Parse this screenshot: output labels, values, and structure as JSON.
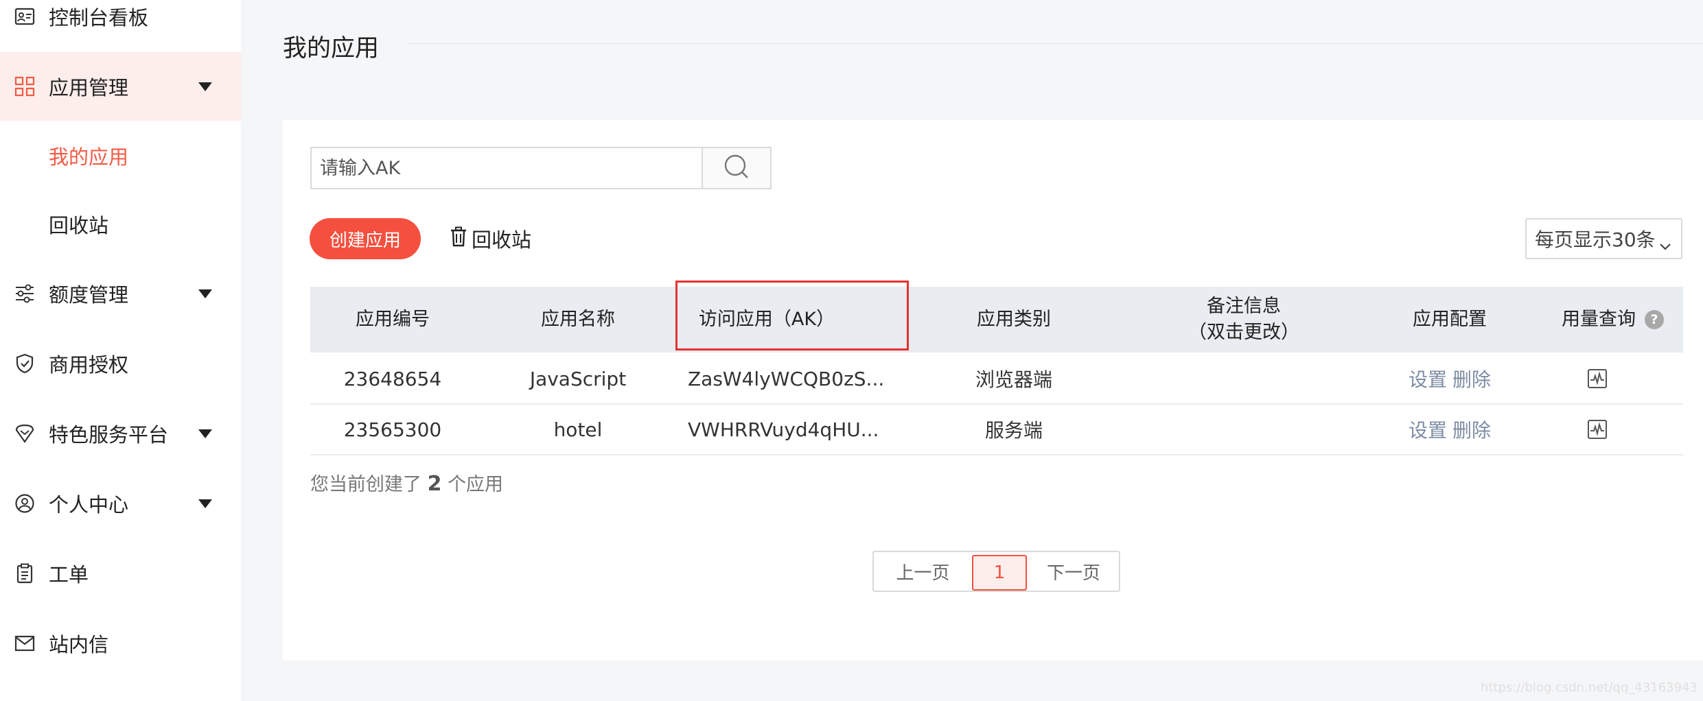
{
  "sidebar": {
    "items": [
      {
        "label": "控制台看板",
        "icon": "id-card-icon"
      },
      {
        "label": "应用管理",
        "icon": "grid-icon",
        "expanded": true
      },
      {
        "label": "我的应用",
        "sub": true,
        "selected": true
      },
      {
        "label": "回收站",
        "sub": true
      },
      {
        "label": "额度管理",
        "icon": "sliders-icon"
      },
      {
        "label": "商用授权",
        "icon": "shield-check-icon"
      },
      {
        "label": "特色服务平台",
        "icon": "gem-icon"
      },
      {
        "label": "个人中心",
        "icon": "user-circle-icon"
      },
      {
        "label": "工单",
        "icon": "clipboard-icon"
      },
      {
        "label": "站内信",
        "icon": "mail-icon"
      }
    ]
  },
  "header": {
    "title": "我的应用"
  },
  "search": {
    "placeholder": "请输入AK"
  },
  "toolbar": {
    "create_label": "创建应用",
    "recycle_label": "回收站",
    "page_size_label": "每页显示30条"
  },
  "table": {
    "headers": {
      "id": "应用编号",
      "name": "应用名称",
      "ak": "访问应用（AK）",
      "type": "应用类别",
      "note_line1": "备注信息",
      "note_line2": "（双击更改）",
      "config": "应用配置",
      "usage": "用量查询"
    },
    "rows": [
      {
        "id": "23648654",
        "name": "JavaScript",
        "ak": "ZasW4lyWCQB0zS...",
        "type": "浏览器端",
        "note": "",
        "set": "设置",
        "del": "删除"
      },
      {
        "id": "23565300",
        "name": "hotel",
        "ak": "VWHRRVuyd4qHU...",
        "type": "服务端",
        "note": "",
        "set": "设置",
        "del": "删除"
      }
    ]
  },
  "summary": {
    "prefix": "您当前创建了",
    "count": "2",
    "suffix": "个应用"
  },
  "pagination": {
    "prev": "上一页",
    "current": "1",
    "next": "下一页"
  },
  "watermark": "https://blog.csdn.net/qq_43163943",
  "colors": {
    "accent": "#f5503f",
    "link": "#7c8ca3",
    "highlight_border": "#e5322d"
  }
}
